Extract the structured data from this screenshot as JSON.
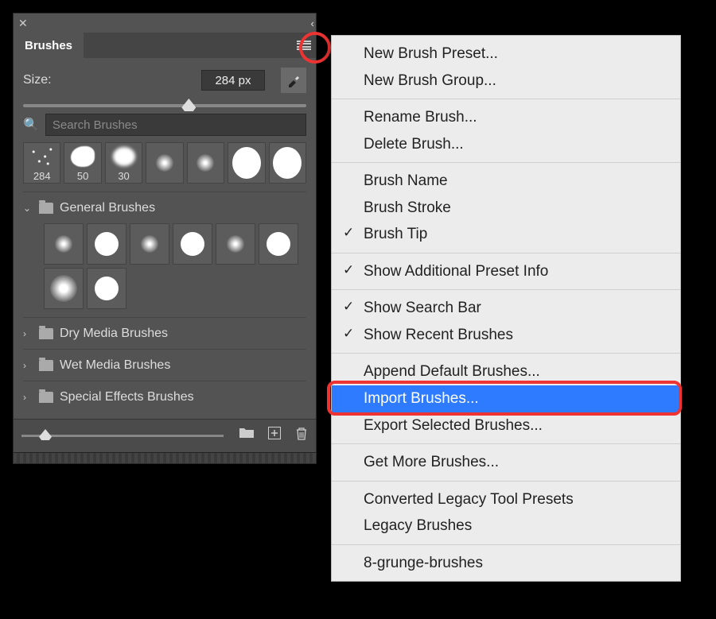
{
  "panel": {
    "title": "Brushes",
    "size_label": "Size:",
    "size_value": "284 px",
    "search_placeholder": "Search Brushes",
    "recent": [
      {
        "label": "284",
        "type": "noise"
      },
      {
        "label": "50",
        "type": "splat"
      },
      {
        "label": "30",
        "type": "cloud"
      },
      {
        "label": "",
        "type": "soft"
      },
      {
        "label": "",
        "type": "soft"
      },
      {
        "label": "",
        "type": "hard-lg"
      },
      {
        "label": "",
        "type": "hard-lg"
      }
    ],
    "groups": [
      {
        "name": "General Brushes",
        "open": true,
        "swatches": [
          "soft",
          "hard",
          "soft",
          "hard",
          "soft",
          "hard",
          "softlg",
          "hard"
        ]
      },
      {
        "name": "Dry Media Brushes",
        "open": false
      },
      {
        "name": "Wet Media Brushes",
        "open": false
      },
      {
        "name": "Special Effects Brushes",
        "open": false
      }
    ]
  },
  "menu": {
    "sections": [
      [
        {
          "label": "New Brush Preset..."
        },
        {
          "label": "New Brush Group..."
        }
      ],
      [
        {
          "label": "Rename Brush..."
        },
        {
          "label": "Delete Brush..."
        }
      ],
      [
        {
          "label": "Brush Name"
        },
        {
          "label": "Brush Stroke"
        },
        {
          "label": "Brush Tip",
          "checked": true
        }
      ],
      [
        {
          "label": "Show Additional Preset Info",
          "checked": true
        }
      ],
      [
        {
          "label": "Show Search Bar",
          "checked": true
        },
        {
          "label": "Show Recent Brushes",
          "checked": true
        }
      ],
      [
        {
          "label": "Append Default Brushes..."
        },
        {
          "label": "Import Brushes...",
          "highlight": true
        },
        {
          "label": "Export Selected Brushes..."
        }
      ],
      [
        {
          "label": "Get More Brushes..."
        }
      ],
      [
        {
          "label": "Converted Legacy Tool Presets"
        },
        {
          "label": "Legacy Brushes"
        }
      ],
      [
        {
          "label": "8-grunge-brushes"
        }
      ]
    ]
  }
}
